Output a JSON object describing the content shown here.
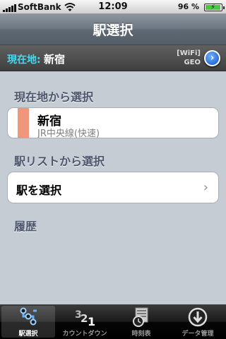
{
  "status_bar": {
    "carrier": "SoftBank",
    "time": "12:09",
    "battery_percent": "96 %"
  },
  "nav": {
    "title": "駅選択"
  },
  "location": {
    "label": "現在地:",
    "station": "新宿",
    "wifi_tag": "[WiFi]",
    "geo_tag": "GEO"
  },
  "sections": {
    "current": {
      "header": "現在地から選択",
      "station_name": "新宿",
      "line_name": "JR中央線(快速)",
      "line_color": "#f0967a"
    },
    "list": {
      "header": "駅リストから選択",
      "cell_label": "駅を選択"
    },
    "history": {
      "header": "履歴"
    }
  },
  "tabs": [
    {
      "label": "駅選択",
      "icon": "station-select-icon",
      "active": true
    },
    {
      "label": "カウントダウン",
      "icon": "countdown-icon",
      "active": false
    },
    {
      "label": "時刻表",
      "icon": "timetable-icon",
      "active": false
    },
    {
      "label": "データ管理",
      "icon": "download-icon",
      "active": false
    }
  ]
}
